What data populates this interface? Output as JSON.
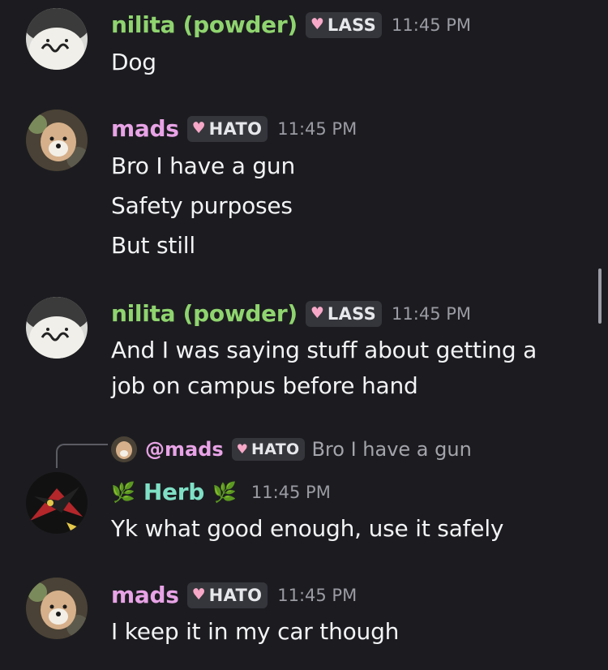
{
  "messages": [
    {
      "username": "nilita (powder)",
      "role_tag": "LASS",
      "time": "11:45 PM",
      "lines": [
        "Dog"
      ]
    },
    {
      "username": "mads",
      "role_tag": "HATO",
      "time": "11:45 PM",
      "lines": [
        "Bro I have a gun",
        "Safety purposes",
        "But still"
      ]
    },
    {
      "username": "nilita (powder)",
      "role_tag": "LASS",
      "time": "11:45 PM",
      "lines": [
        "And I was saying stuff about getting a",
        "job on campus before hand"
      ]
    },
    {
      "reply": {
        "mention": "@mads",
        "role_tag": "HATO",
        "text": "Bro I have a gun"
      },
      "username": "Herb",
      "leaf_left": "🌿",
      "leaf_right": "🌿",
      "time": "11:45 PM",
      "lines": [
        "Yk what good enough, use it safely"
      ]
    },
    {
      "username": "mads",
      "role_tag": "HATO",
      "time": "11:45 PM",
      "lines": [
        "I keep it in my car though"
      ]
    }
  ],
  "icons": {
    "tag_heart": "♥"
  },
  "colors": {
    "background": "#1c1c20",
    "nilita": "#8fd46f",
    "mads": "#e8a3e6",
    "herb": "#7fe0c6"
  }
}
